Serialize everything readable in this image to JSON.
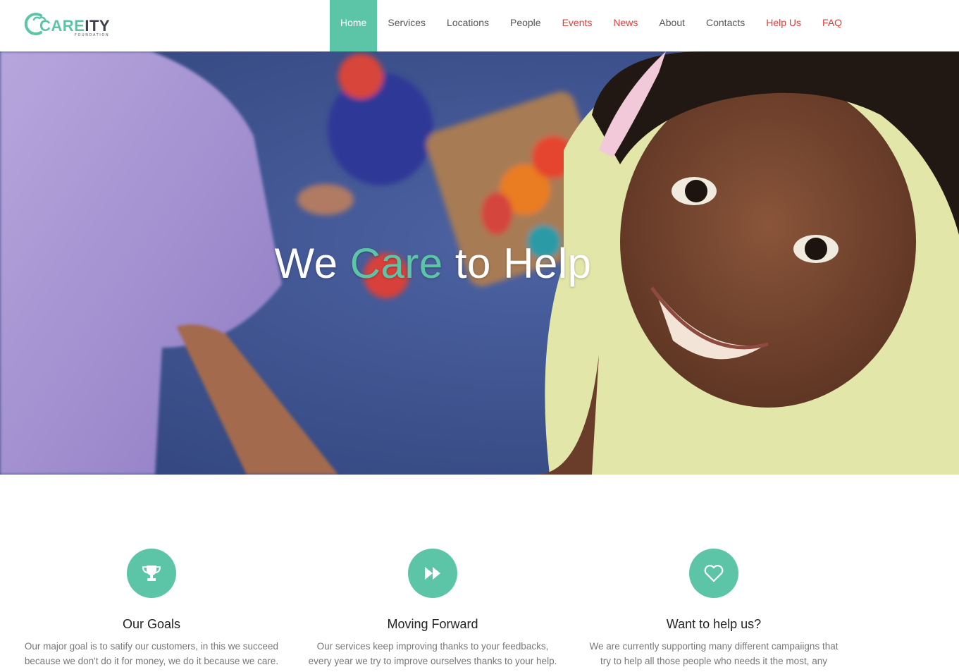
{
  "brand": {
    "word_care": "CARE",
    "word_ity": "ITY",
    "tagline": "FOUNDATION",
    "accent_color": "#5cc5a8"
  },
  "nav": {
    "items": [
      {
        "label": "Home",
        "state": "active"
      },
      {
        "label": "Services"
      },
      {
        "label": "Locations"
      },
      {
        "label": "People"
      },
      {
        "label": "Events",
        "color": "#d9403a"
      },
      {
        "label": "News",
        "color": "#d9403a"
      },
      {
        "label": "About"
      },
      {
        "label": "Contacts"
      },
      {
        "label": "Help Us",
        "color": "#d9403a"
      },
      {
        "label": "FAQ",
        "color": "#d9403a"
      }
    ]
  },
  "hero": {
    "title_before": "We ",
    "title_accent": "Care",
    "title_after": " to Help"
  },
  "features": [
    {
      "icon": "trophy-icon",
      "title": "Our Goals",
      "text": "Our major goal is to satify our customers, in this we succeed because we don't do it for money, we do it because we care."
    },
    {
      "icon": "fast-forward-icon",
      "title": "Moving Forward",
      "text": "Our services keep improving thanks to your feedbacks, every year we try to improve ourselves thanks to your help."
    },
    {
      "icon": "heart-icon",
      "title": "Want to help us?",
      "text": "We are currently supporting many different campaiigns that try to help all those people who needs it the most, any"
    }
  ]
}
